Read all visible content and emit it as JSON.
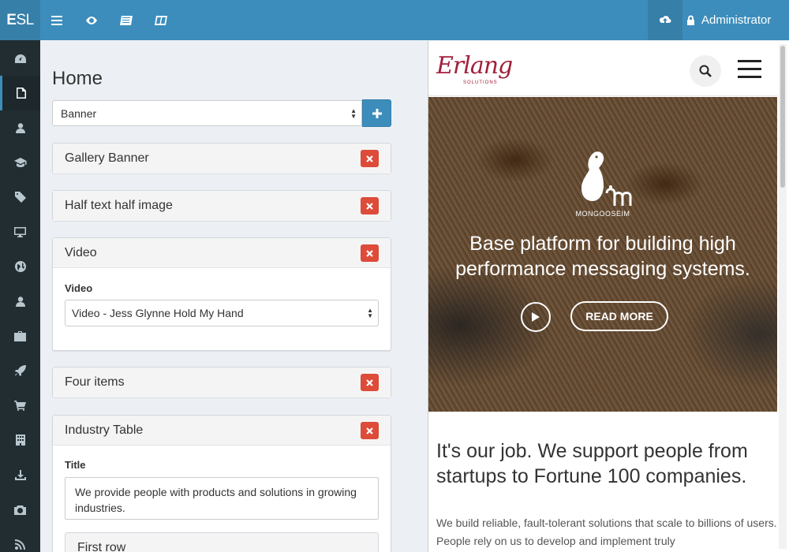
{
  "app": {
    "logo_bold": "E",
    "logo_rest": "SL"
  },
  "topbar": {
    "user_name": "Administrator"
  },
  "editor": {
    "page_title": "Home",
    "block_type_select": "Banner",
    "blocks": [
      {
        "title": "Gallery Banner"
      },
      {
        "title": "Half text half image"
      },
      {
        "title": "Video",
        "field_label": "Video",
        "field_value": "Video - Jess Glynne Hold My Hand"
      },
      {
        "title": "Four items"
      },
      {
        "title": "Industry Table",
        "field_label": "Title",
        "field_value": "We provide people with products and solutions in growing industries.",
        "sub_block_title": "First row"
      }
    ]
  },
  "preview": {
    "logo_text": "Erlang",
    "logo_sub": "SOLUTIONS",
    "hero": {
      "brand_label": "MONGOOSEIM",
      "headline": "Base platform for building high performance messaging systems.",
      "cta": "READ MORE",
      "slide_count": 5,
      "active_slide": 2
    },
    "heading": "It's our job. We support people from startups to Fortune 100 companies.",
    "body": "We build reliable, fault-tolerant solutions that scale to billions of users. People rely on us to develop and implement truly"
  },
  "colors": {
    "primary": "#3c8dbc",
    "sidebar": "#222d32",
    "danger": "#dd4b39",
    "brand": "#a2203c"
  }
}
